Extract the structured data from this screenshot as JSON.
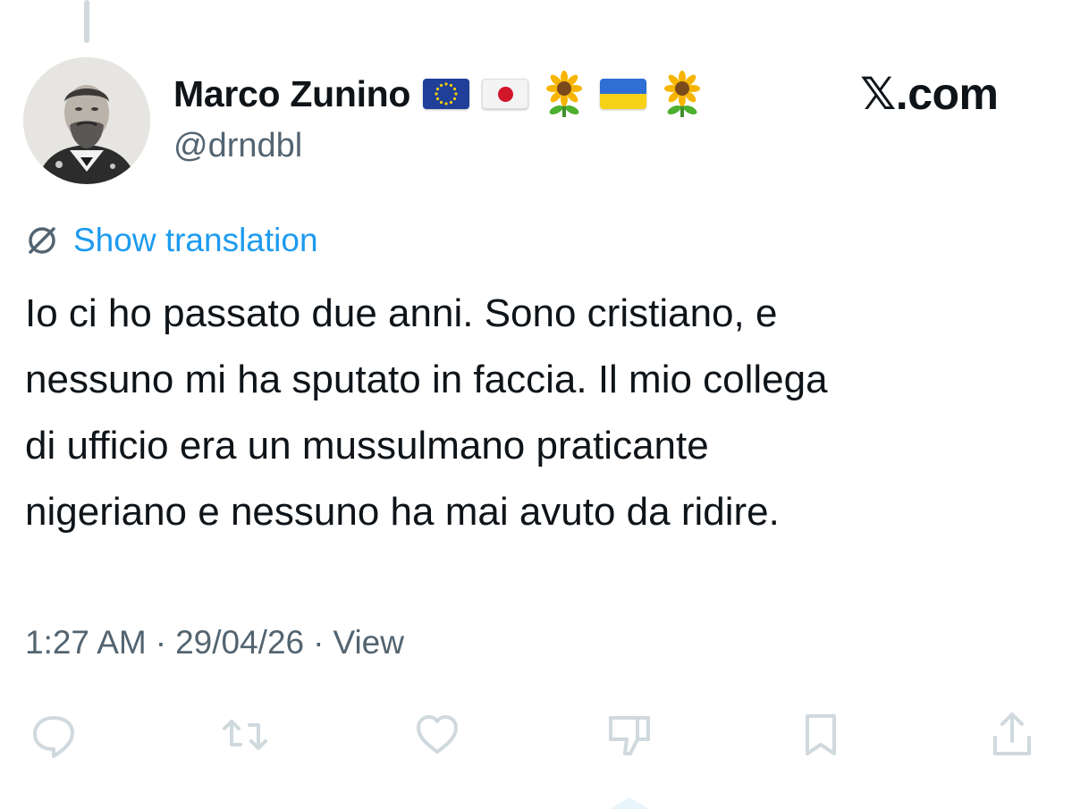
{
  "author": {
    "display_name": "Marco Zunino",
    "handle": "@drndbl",
    "badges": [
      "eu-flag",
      "japan-flag",
      "sunflower",
      "ukraine-flag",
      "sunflower"
    ]
  },
  "brand": {
    "logo_letter": "𝕏",
    "suffix": ".com"
  },
  "translation": {
    "label": "Show translation",
    "icon": "translate-globe-icon"
  },
  "tweet": {
    "text": "Io ci ho passato due anni. Sono cristiano, e\nnessuno mi ha sputato in faccia. Il mio collega\ndi ufficio era un mussulmano praticante\nnigeriano e nessuno ha mai avuto da ridire."
  },
  "meta": {
    "time": "1:27 AM",
    "sep1": "·",
    "date": "29/04/26",
    "sep2": "·",
    "views": "View"
  },
  "actions": [
    "reply-icon",
    "retweet-icon",
    "like-icon",
    "dislike-icon",
    "bookmark-icon",
    "share-icon"
  ],
  "colors": {
    "accent": "#1d9bf0",
    "muted": "#536471",
    "text": "#0f1419",
    "icon": "#cfd9de"
  }
}
